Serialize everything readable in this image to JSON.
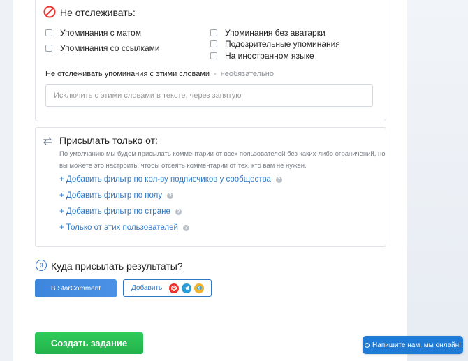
{
  "dont_track": {
    "title": "Не отслеживать:",
    "options_left": [
      "Упоминания с матом",
      "Упоминания со ссылками"
    ],
    "options_right": [
      "Упоминания без аватарки",
      "Подозрительные упоминания",
      "На иностранном языке"
    ],
    "exclude_label": "Не отслеживать упоминания с этими словами",
    "exclude_dash": "-",
    "exclude_optional": "необязательно",
    "exclude_placeholder": "Исключить с этими словами в тексте, через запятую"
  },
  "send_from": {
    "title": "Присылать только от:",
    "description": "По умолчанию мы будем присылать комментарии от всех пользователей без каких-либо ограничений, но вы можете это настроить, чтобы отсеять комментарии от тех, кто вам не нужен.",
    "links": [
      "+ Добавить фильтр по кол-ву подписчиков у сообщества",
      "+ Добавить фильтр по полу",
      "+ Добавить фильтр по стране",
      "+ Только от этих пользователей"
    ]
  },
  "results": {
    "step": "3",
    "title": "Куда присылать результаты?",
    "star_button": "В StarComment",
    "add_button": "Добавить"
  },
  "create_button": "Создать задание",
  "chat_button": "Напишите нам, мы онлайн!",
  "colors": {
    "accent": "#2f78c4",
    "green": "#22b24b",
    "chat": "#1f7bd6",
    "mail": "#e8332c",
    "telegram": "#2a9ed8",
    "skype": "#f2b32a"
  }
}
